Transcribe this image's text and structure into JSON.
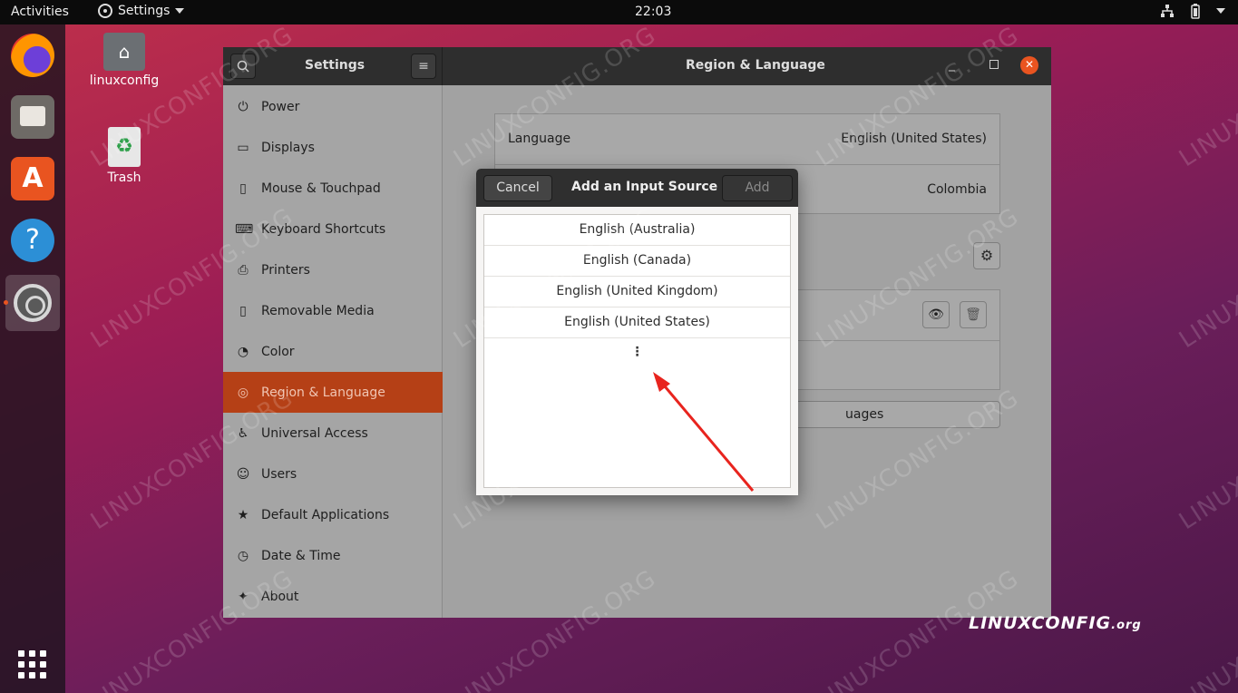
{
  "topbar": {
    "activities": "Activities",
    "app_menu": "Settings",
    "clock": "22:03"
  },
  "desktop": {
    "folder_label": "linuxconfig",
    "trash_label": "Trash"
  },
  "window": {
    "sidebar_title": "Settings",
    "title": "Region & Language"
  },
  "sidebar": {
    "items": [
      {
        "label": "Power",
        "icon": "power-icon"
      },
      {
        "label": "Displays",
        "icon": "display-icon"
      },
      {
        "label": "Mouse & Touchpad",
        "icon": "mouse-icon"
      },
      {
        "label": "Keyboard Shortcuts",
        "icon": "keyboard-icon"
      },
      {
        "label": "Printers",
        "icon": "printer-icon"
      },
      {
        "label": "Removable Media",
        "icon": "media-icon"
      },
      {
        "label": "Color",
        "icon": "color-icon"
      },
      {
        "label": "Region & Language",
        "icon": "globe-icon",
        "active": true
      },
      {
        "label": "Universal Access",
        "icon": "accessibility-icon"
      },
      {
        "label": "Users",
        "icon": "user-icon"
      },
      {
        "label": "Default Applications",
        "icon": "star-icon"
      },
      {
        "label": "Date & Time",
        "icon": "clock-icon"
      },
      {
        "label": "About",
        "icon": "info-icon"
      }
    ]
  },
  "region": {
    "language_label": "Language",
    "language_value": "English (United States)",
    "formats_value": "Colombia",
    "manage_partial": "uages"
  },
  "dialog": {
    "cancel": "Cancel",
    "title": "Add an Input Source",
    "add": "Add",
    "items": [
      "English (Australia)",
      "English (Canada)",
      "English (United Kingdom)",
      "English (United States)"
    ],
    "more": "⋮"
  },
  "watermark": "LINUXCONFIG.ORG",
  "brand": {
    "main": "LINUXCONFIG",
    "suffix": ".org"
  },
  "colors": {
    "accent": "#e95420",
    "active_sidebar": "#b54016",
    "arrow": "#e8241e"
  }
}
